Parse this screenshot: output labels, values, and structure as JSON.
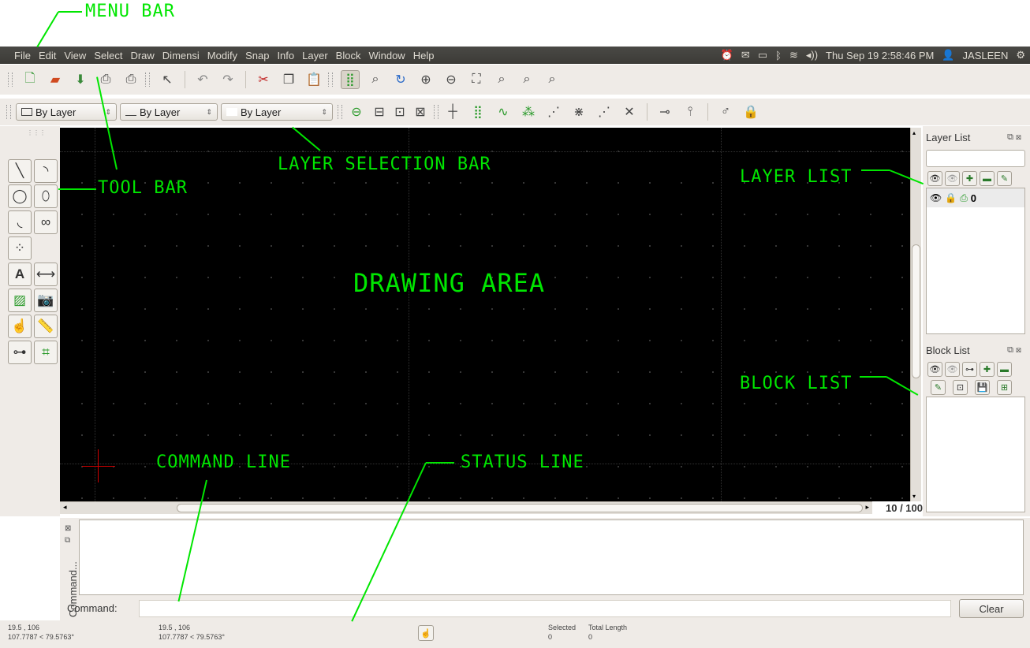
{
  "menubar": {
    "items": [
      "File",
      "Edit",
      "View",
      "Select",
      "Draw",
      "Dimensi",
      "Modify",
      "Snap",
      "Info",
      "Layer",
      "Block",
      "Window",
      "Help"
    ],
    "datetime": "Thu Sep 19  2:58:46 PM",
    "user": "JASLEEN",
    "tray_icons": [
      "alarm-icon",
      "mail-icon",
      "battery-icon",
      "bluetooth-icon",
      "wifi-icon",
      "volume-icon",
      "settings-icon"
    ]
  },
  "toolbar2": {
    "color_combo": "By Layer",
    "linetype_combo": "By Layer",
    "width_combo": "By Layer"
  },
  "annotations": {
    "menu_bar": "MENU BAR",
    "layer_selection_bar": "LAYER SELECTION BAR",
    "tool_bar": "TOOL BAR",
    "layer_list": "LAYER LIST",
    "drawing_area": "DRAWING AREA",
    "block_list": "BLOCK LIST",
    "command_line": "COMMAND LINE",
    "status_line": "STATUS LINE"
  },
  "zoom": "10 / 100",
  "layer_panel": {
    "title": "Layer List",
    "layers": [
      {
        "name": "0"
      }
    ]
  },
  "block_panel": {
    "title": "Block List"
  },
  "command": {
    "dock_title": "Command...",
    "label": "Command:",
    "clear_label": "Clear"
  },
  "status": {
    "abs_coord": "19.5 , 106",
    "abs_polar": "107.7787 < 79.5763°",
    "rel_coord": "19.5 , 106",
    "rel_polar": "107.7787 < 79.5763°",
    "selected_label": "Selected",
    "selected_value": "0",
    "total_length_label": "Total Length",
    "total_length_value": "0"
  }
}
